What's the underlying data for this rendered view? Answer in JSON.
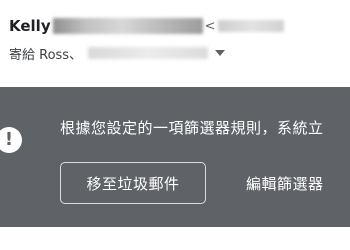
{
  "header": {
    "sender_name": "Kelly",
    "email_open_bracket": "<",
    "recipient_prefix": "寄給 Ross、"
  },
  "banner": {
    "message": "根據您設定的一項篩選器規則，系統立",
    "warning_glyph": "!",
    "move_to_spam_label": "移至垃圾郵件",
    "edit_filter_label": "編輯篩選器",
    "background_color": "#5f6368"
  },
  "icons": {
    "warning": "exclamation-circle-icon",
    "expand_recipients": "caret-down-icon"
  }
}
